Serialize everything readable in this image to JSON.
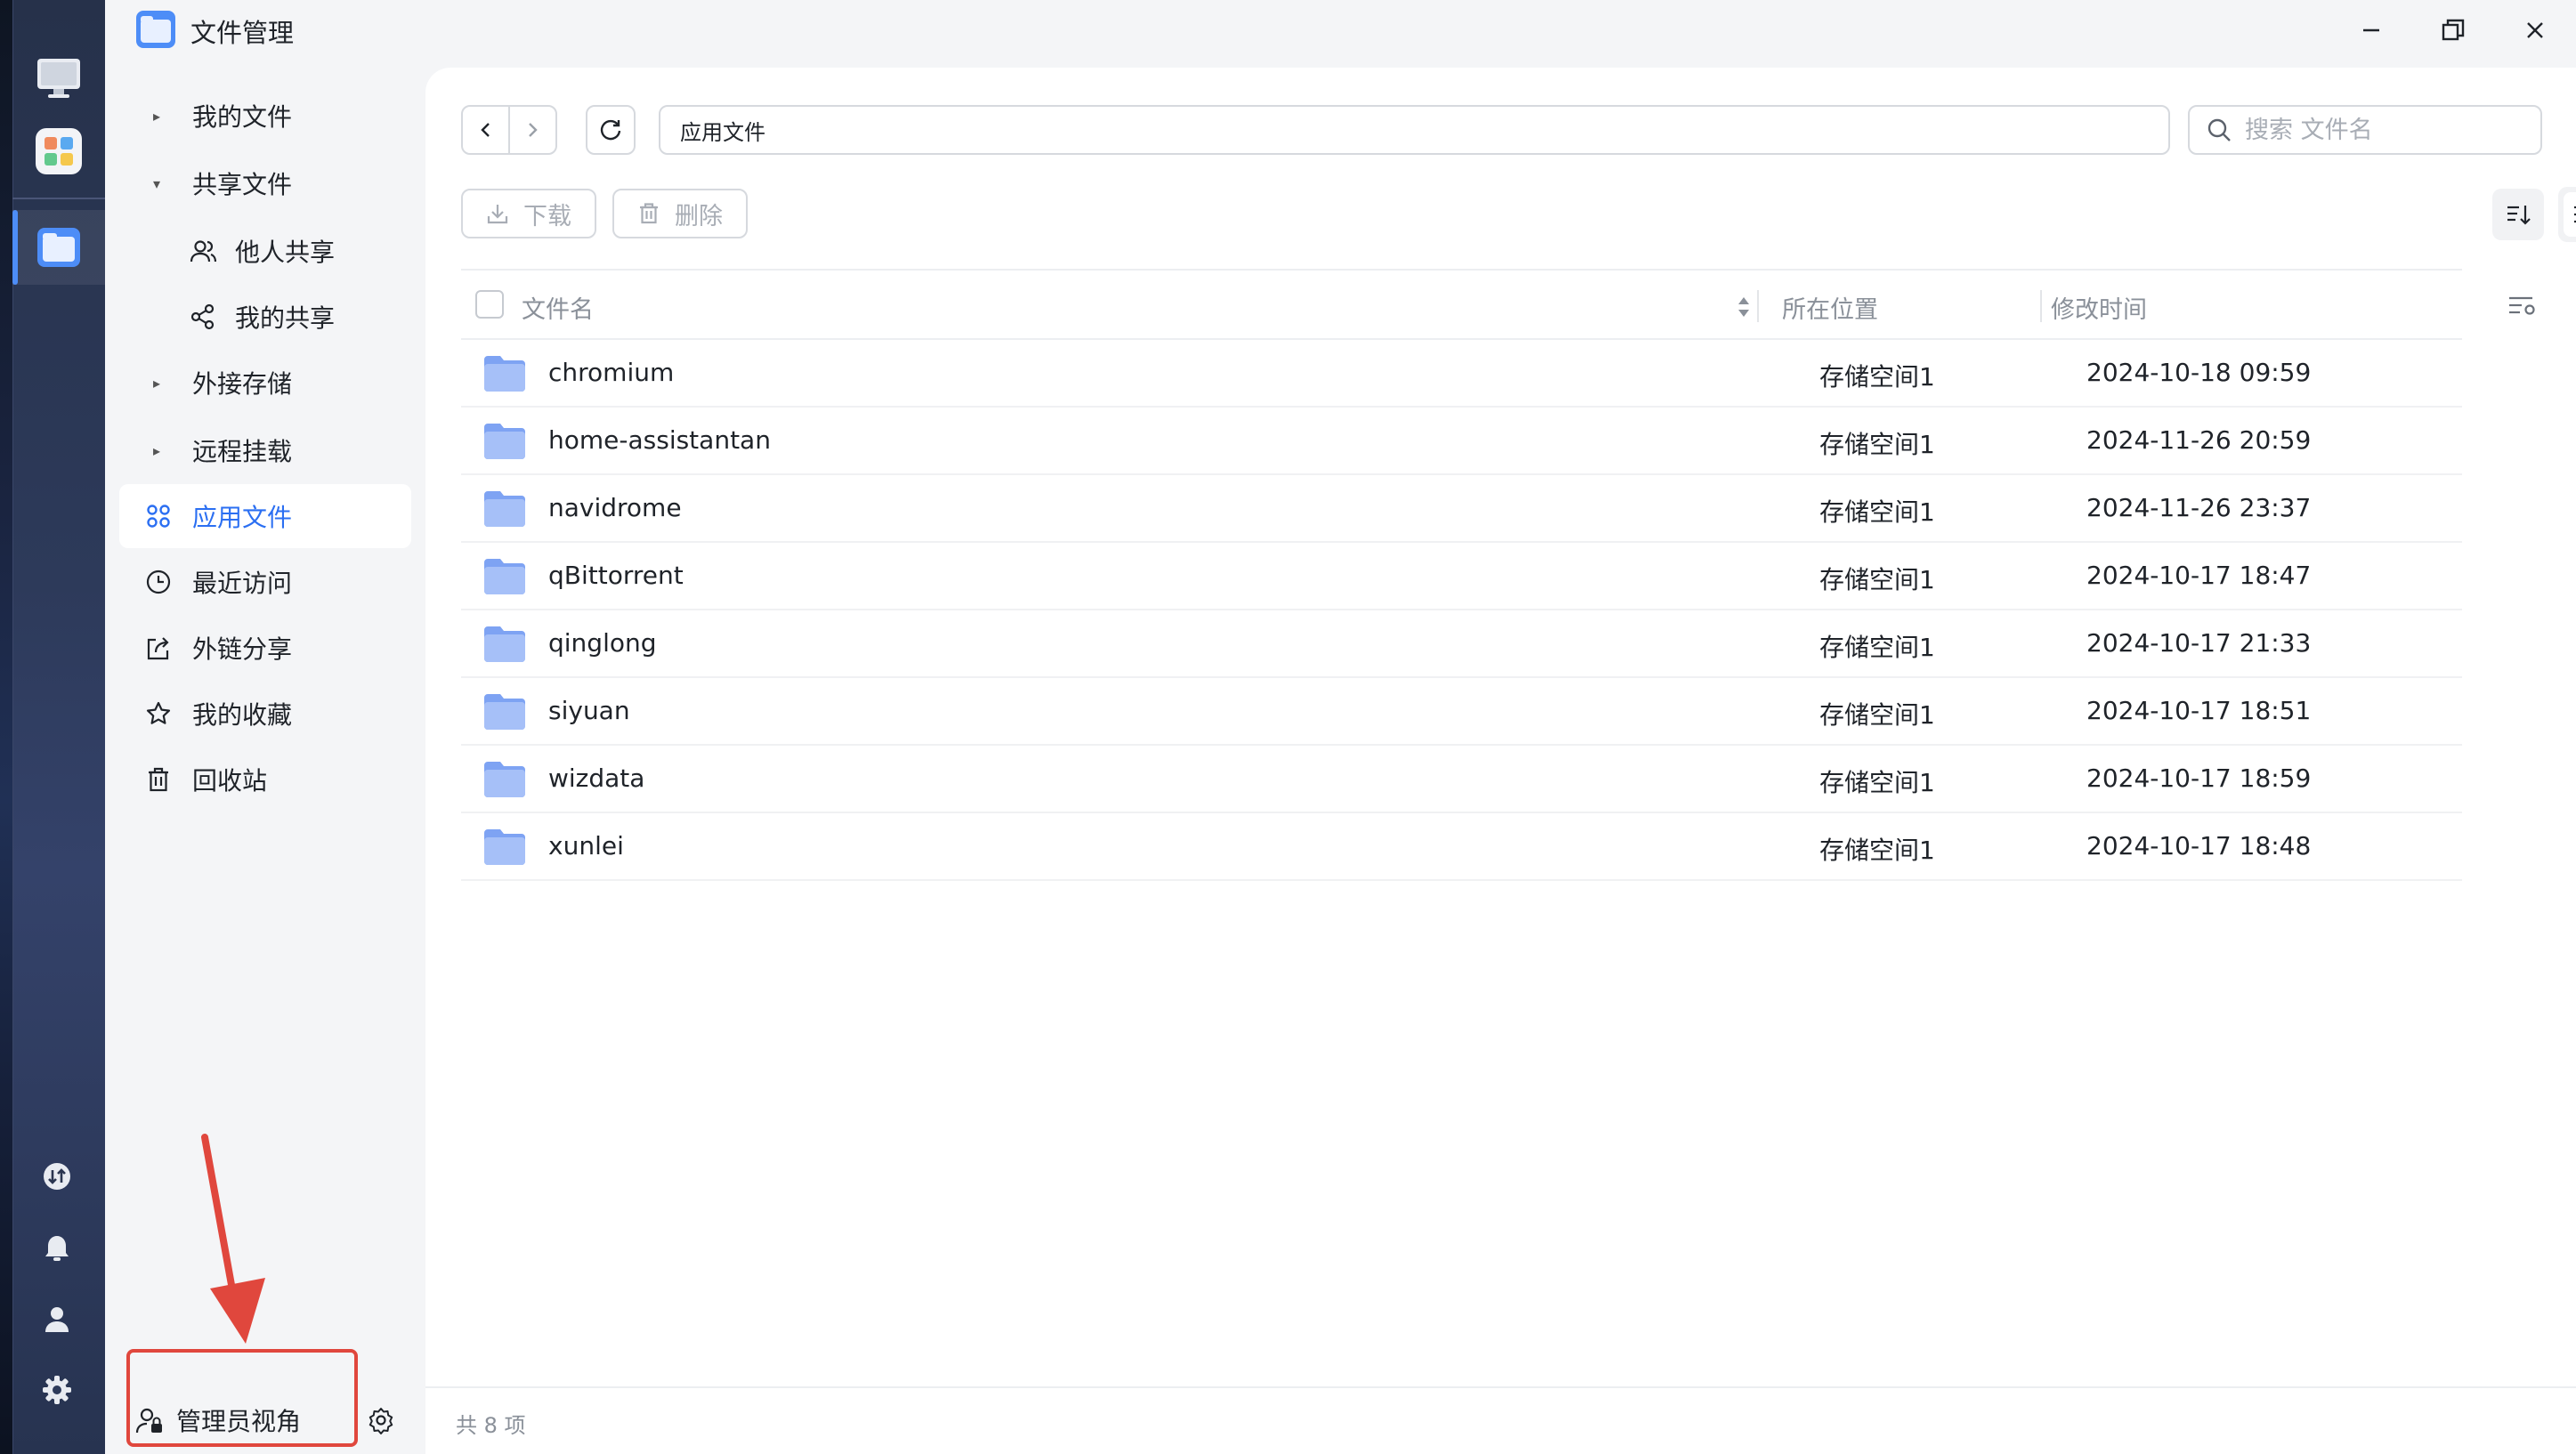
{
  "window": {
    "title": "文件管理"
  },
  "sidebar": {
    "items": [
      {
        "label": "我的文件"
      },
      {
        "label": "共享文件"
      },
      {
        "label": "他人共享"
      },
      {
        "label": "我的共享"
      },
      {
        "label": "外接存储"
      },
      {
        "label": "远程挂载"
      },
      {
        "label": "应用文件"
      },
      {
        "label": "最近访问"
      },
      {
        "label": "外链分享"
      },
      {
        "label": "我的收藏"
      },
      {
        "label": "回收站"
      }
    ],
    "admin_label": "管理员视角"
  },
  "toolbar": {
    "path": "应用文件",
    "search_placeholder": "搜索 文件名",
    "download_label": "下载",
    "delete_label": "删除"
  },
  "table": {
    "headers": {
      "name": "文件名",
      "location": "所在位置",
      "modified": "修改时间"
    },
    "rows": [
      {
        "name": "chromium",
        "location": "存储空间1",
        "modified": "2024-10-18 09:59"
      },
      {
        "name": "home-assistantan",
        "location": "存储空间1",
        "modified": "2024-11-26 20:59"
      },
      {
        "name": "navidrome",
        "location": "存储空间1",
        "modified": "2024-11-26 23:37"
      },
      {
        "name": "qBittorrent",
        "location": "存储空间1",
        "modified": "2024-10-17 18:47"
      },
      {
        "name": "qinglong",
        "location": "存储空间1",
        "modified": "2024-10-17 21:33"
      },
      {
        "name": "siyuan",
        "location": "存储空间1",
        "modified": "2024-10-17 18:51"
      },
      {
        "name": "wizdata",
        "location": "存储空间1",
        "modified": "2024-10-17 18:59"
      },
      {
        "name": "xunlei",
        "location": "存储空间1",
        "modified": "2024-10-17 18:48"
      }
    ]
  },
  "footer": {
    "count_text": "共 8 项"
  },
  "colors": {
    "accent": "#2b6ff2",
    "highlight_box": "#e0473d",
    "folder": "#8fb0f5"
  }
}
